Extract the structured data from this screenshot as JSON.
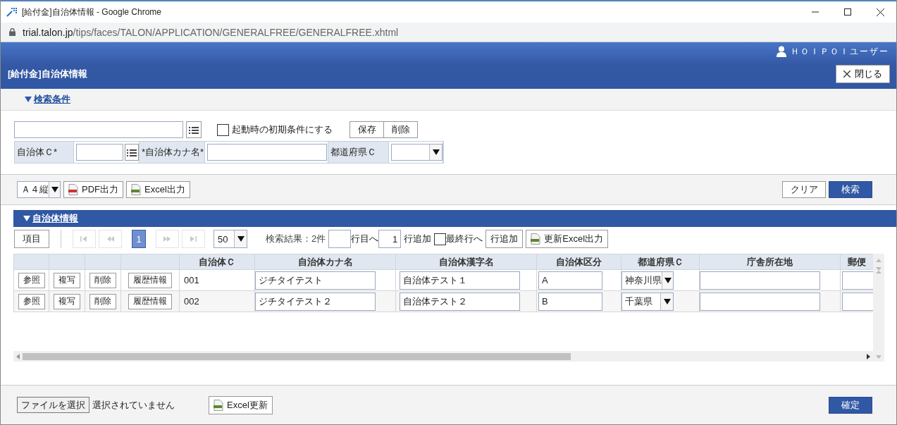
{
  "window": {
    "title": "[給付金]自治体情報 - Google Chrome",
    "url_host": "trial.talon.jp",
    "url_path": "/tips/faces/TALON/APPLICATION/GENERALFREE/GENERALFREE.xhtml"
  },
  "header": {
    "user": "ＨＯＩＰＯＩユーザー",
    "title": "[給付金]自治体情報",
    "close_button": "閉じる"
  },
  "search_conditions": {
    "heading": "検索条件",
    "expanded": true,
    "default_checkbox": {
      "label": "起動時の初期条件にする",
      "checked": false
    },
    "buttons": [
      "保存",
      "削除"
    ],
    "fields": [
      {
        "kind": "lookup",
        "label": "自治体Ｃ*"
      },
      {
        "kind": "text",
        "label": "*自治体カナ名*"
      },
      {
        "kind": "select",
        "label": "都道府県Ｃ"
      }
    ]
  },
  "toolbar": {
    "paper": "Ａ４縦",
    "pdf_button": "PDF出力",
    "excel_button": "Excel出力",
    "clear_button": "クリア",
    "search_button": "検索"
  },
  "results": {
    "heading": "自治体情報",
    "expanded": true,
    "columns_button": "項目",
    "pager": [
      {
        "kind": "first",
        "disabled": true
      },
      {
        "kind": "prev",
        "disabled": true
      },
      {
        "kind": "page",
        "label": "1",
        "selected": true
      },
      {
        "kind": "next",
        "disabled": true
      },
      {
        "kind": "last",
        "disabled": true
      }
    ],
    "page_size": "50",
    "result_count": "検索結果：2件",
    "goto_suffix": "行目へ",
    "add_count": "1",
    "add_suffix": "行追加",
    "last_row_checkbox": {
      "label": "最終行へ",
      "checked": false
    },
    "add_row_button": "行追加",
    "excel_export_button": "更新Excel出力",
    "columns": [
      "自治体Ｃ",
      "自治体カナ名",
      "自治体漢字名",
      "自治体区分",
      "都道府県Ｃ",
      "庁舎所在地",
      "郵便"
    ],
    "rows": [
      {
        "actions": [
          "参照",
          "複写",
          "削除",
          "履歴情報"
        ],
        "code": "001",
        "kana": "ジチタイテスト",
        "kanji": "自治体テスト１",
        "type": "A",
        "prefecture": "神奈川県"
      },
      {
        "actions": [
          "参照",
          "複写",
          "削除",
          "履歴情報"
        ],
        "code": "002",
        "kana": "ジチタイテスト２",
        "kanji": "自治体テスト２",
        "type": "B",
        "prefecture": "千葉県"
      }
    ]
  },
  "footer": {
    "file_button": "ファイルを選択",
    "file_status": "選択されていません",
    "excel_update_button": "Excel更新",
    "confirm_button": "確定"
  }
}
